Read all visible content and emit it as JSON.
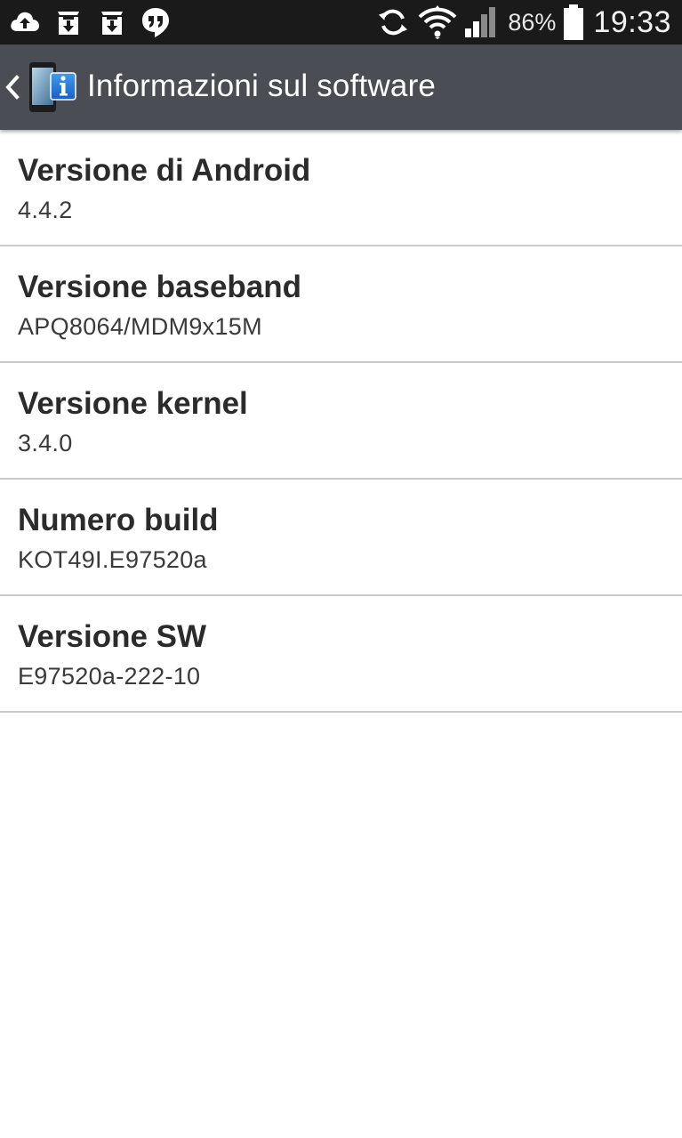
{
  "status_bar": {
    "left_icons": [
      "cloud-upload-icon",
      "download-box-icon",
      "download-box-icon",
      "hangouts-icon"
    ],
    "right_icons": [
      "sync-icon",
      "wifi-icon",
      "signal-icon",
      "battery-icon"
    ],
    "battery_percent": "86%",
    "battery_level": 0.86,
    "time": "19:33"
  },
  "action_bar": {
    "back_icon": "chevron-left-icon",
    "app_icon": "software-info-icon",
    "title": "Informazioni sul software",
    "background_color": "#4a4d53"
  },
  "items": [
    {
      "title": "Versione di Android",
      "value": "4.4.2"
    },
    {
      "title": "Versione baseband",
      "value": "APQ8064/MDM9x15M"
    },
    {
      "title": "Versione kernel",
      "value": "3.4.0"
    },
    {
      "title": "Numero build",
      "value": "KOT49I.E97520a"
    },
    {
      "title": "Versione SW",
      "value": "E97520a-222-10"
    }
  ]
}
